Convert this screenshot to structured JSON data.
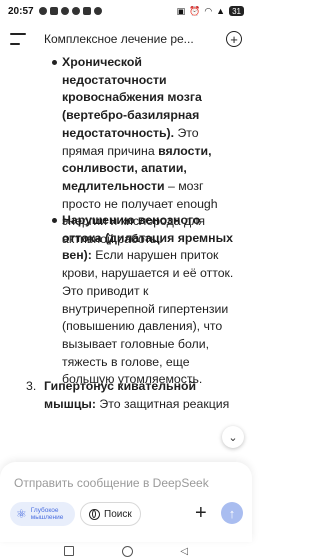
{
  "status_bar": {
    "time": "20:57",
    "battery": "31"
  },
  "header": {
    "title": "Комплексное лечение ре..."
  },
  "content": {
    "bullet1": {
      "bold": "Хронической недостаточности кровоснабжения мозга (вертебро-базилярная недостаточность).",
      "text1": " Это прямая причина ",
      "bold2": "вялости, сонливости, апатии, медлительности",
      "text2": " – мозг просто не получает enough энергии и кислорода для активной работы."
    },
    "bullet2": {
      "bold": "Нарушению венозного оттока (дилатация яремных вен):",
      "text": " Если нарушен приток крови, нарушается и её отток. Это приводит к внутричерепной гипертензии (повышению давления), что вызывает головные боли, тяжесть в голове, еще большую утомляемость."
    },
    "item3": {
      "number": "3.",
      "bold": "Гипертонус кивательной мышцы:",
      "text": " Это защитная реакция организма. Мышцы напрягаются, пытаясь компенсировать нестабильность позвонков и"
    }
  },
  "composer": {
    "placeholder": "Отправить сообщение в DeepSeek",
    "deep_think_label": "Глубокое мышление",
    "search_label": "Поиск"
  }
}
